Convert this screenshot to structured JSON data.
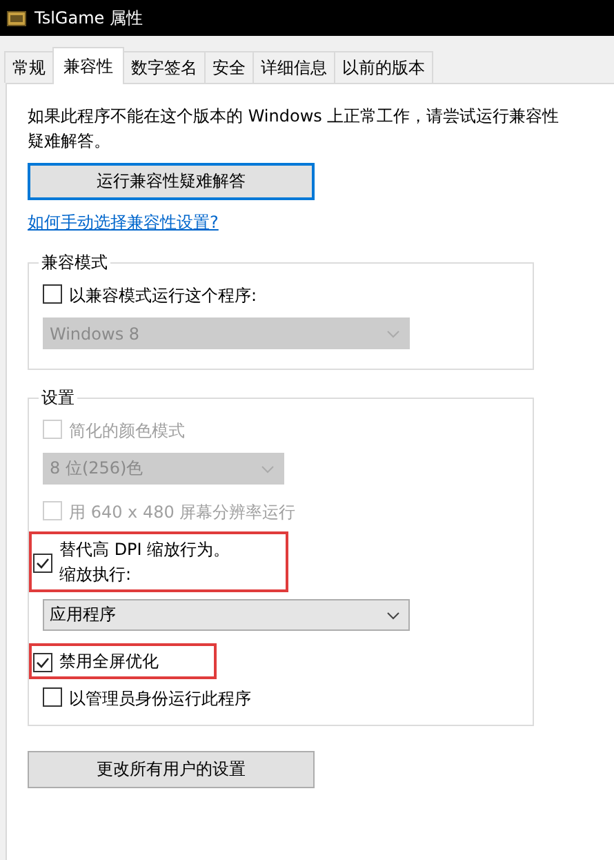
{
  "window": {
    "title": "TslGame 属性"
  },
  "tabs": [
    {
      "label": "常规",
      "selected": false
    },
    {
      "label": "兼容性",
      "selected": true
    },
    {
      "label": "数字签名",
      "selected": false
    },
    {
      "label": "安全",
      "selected": false
    },
    {
      "label": "详细信息",
      "selected": false
    },
    {
      "label": "以前的版本",
      "selected": false
    }
  ],
  "intro": "如果此程序不能在这个版本的 Windows 上正常工作，请尝试运行兼容性疑难解答。",
  "troubleshoot_button": "运行兼容性疑难解答",
  "help_link": "如何手动选择兼容性设置?",
  "groups": [
    {
      "title": "兼容模式",
      "items": [
        {
          "kind": "checkbox",
          "lines": [
            "以兼容模式运行这个程序:"
          ],
          "checked": false,
          "disabled": false,
          "highlighted": false
        },
        {
          "kind": "dropdown",
          "value": "Windows 8",
          "disabled": true
        }
      ]
    },
    {
      "title": "设置",
      "items": [
        {
          "kind": "checkbox",
          "lines": [
            "简化的颜色模式"
          ],
          "checked": false,
          "disabled": true,
          "highlighted": false
        },
        {
          "kind": "dropdown",
          "value": "8 位(256)色",
          "disabled": true
        },
        {
          "kind": "checkbox",
          "lines": [
            "用 640 x 480 屏幕分辨率运行"
          ],
          "checked": false,
          "disabled": true,
          "highlighted": false
        },
        {
          "kind": "checkbox",
          "lines": [
            "替代高 DPI 缩放行为。",
            "缩放执行:"
          ],
          "checked": true,
          "disabled": false,
          "highlighted": true
        },
        {
          "kind": "dropdown",
          "value": "应用程序",
          "disabled": false
        },
        {
          "kind": "checkbox",
          "lines": [
            "禁用全屏优化"
          ],
          "checked": true,
          "disabled": false,
          "highlighted": true
        },
        {
          "kind": "checkbox",
          "lines": [
            "以管理员身份运行此程序"
          ],
          "checked": false,
          "disabled": false,
          "highlighted": false
        }
      ]
    }
  ],
  "all_users_button": "更改所有用户的设置"
}
